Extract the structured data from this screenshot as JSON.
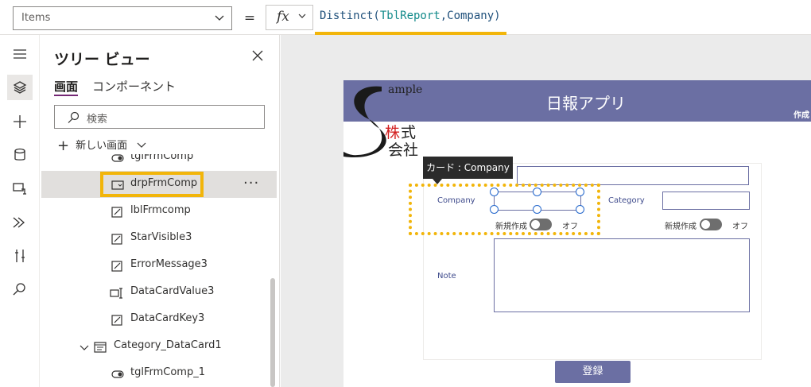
{
  "formula_bar": {
    "property": "Items",
    "equals": "=",
    "fx_label": "fx",
    "formula": {
      "fn": "Distinct(",
      "table": "TblReport",
      "rest": ",Company)"
    }
  },
  "tree_view": {
    "title": "ツリー ビュー",
    "tabs": [
      "画面",
      "コンポーネント"
    ],
    "search_placeholder": "検索",
    "new_screen_label": "新しい画面",
    "more_label": "···",
    "items": [
      {
        "label": "tglFrmComp",
        "icon": "toggle-icon"
      },
      {
        "label": "drpFrmComp",
        "icon": "dropdown-icon"
      },
      {
        "label": "lblFrmcomp",
        "icon": "edit-icon"
      },
      {
        "label": "StarVisible3",
        "icon": "edit-icon"
      },
      {
        "label": "ErrorMessage3",
        "icon": "edit-icon"
      },
      {
        "label": "DataCardValue3",
        "icon": "text-input-icon"
      },
      {
        "label": "DataCardKey3",
        "icon": "edit-icon"
      },
      {
        "label": "Category_DataCard1",
        "icon": "card-icon"
      },
      {
        "label": "tglFrmComp_1",
        "icon": "toggle-icon"
      }
    ]
  },
  "app": {
    "title": "日報アプリ",
    "creator_label": "作成",
    "logo_text": {
      "sample": "ample",
      "line1_red": "株",
      "line1_black": "式",
      "line2": "会社"
    },
    "tooltip": "カード : Company",
    "fields": {
      "company": "Company",
      "category": "Category",
      "note": "Note"
    },
    "toggle_label": "新規作成",
    "toggle_state": "オフ",
    "register_button": "登録"
  },
  "colors": {
    "accent": "#f2b50a",
    "header": "#6b6fa3",
    "field_border": "#6b6fa3"
  }
}
